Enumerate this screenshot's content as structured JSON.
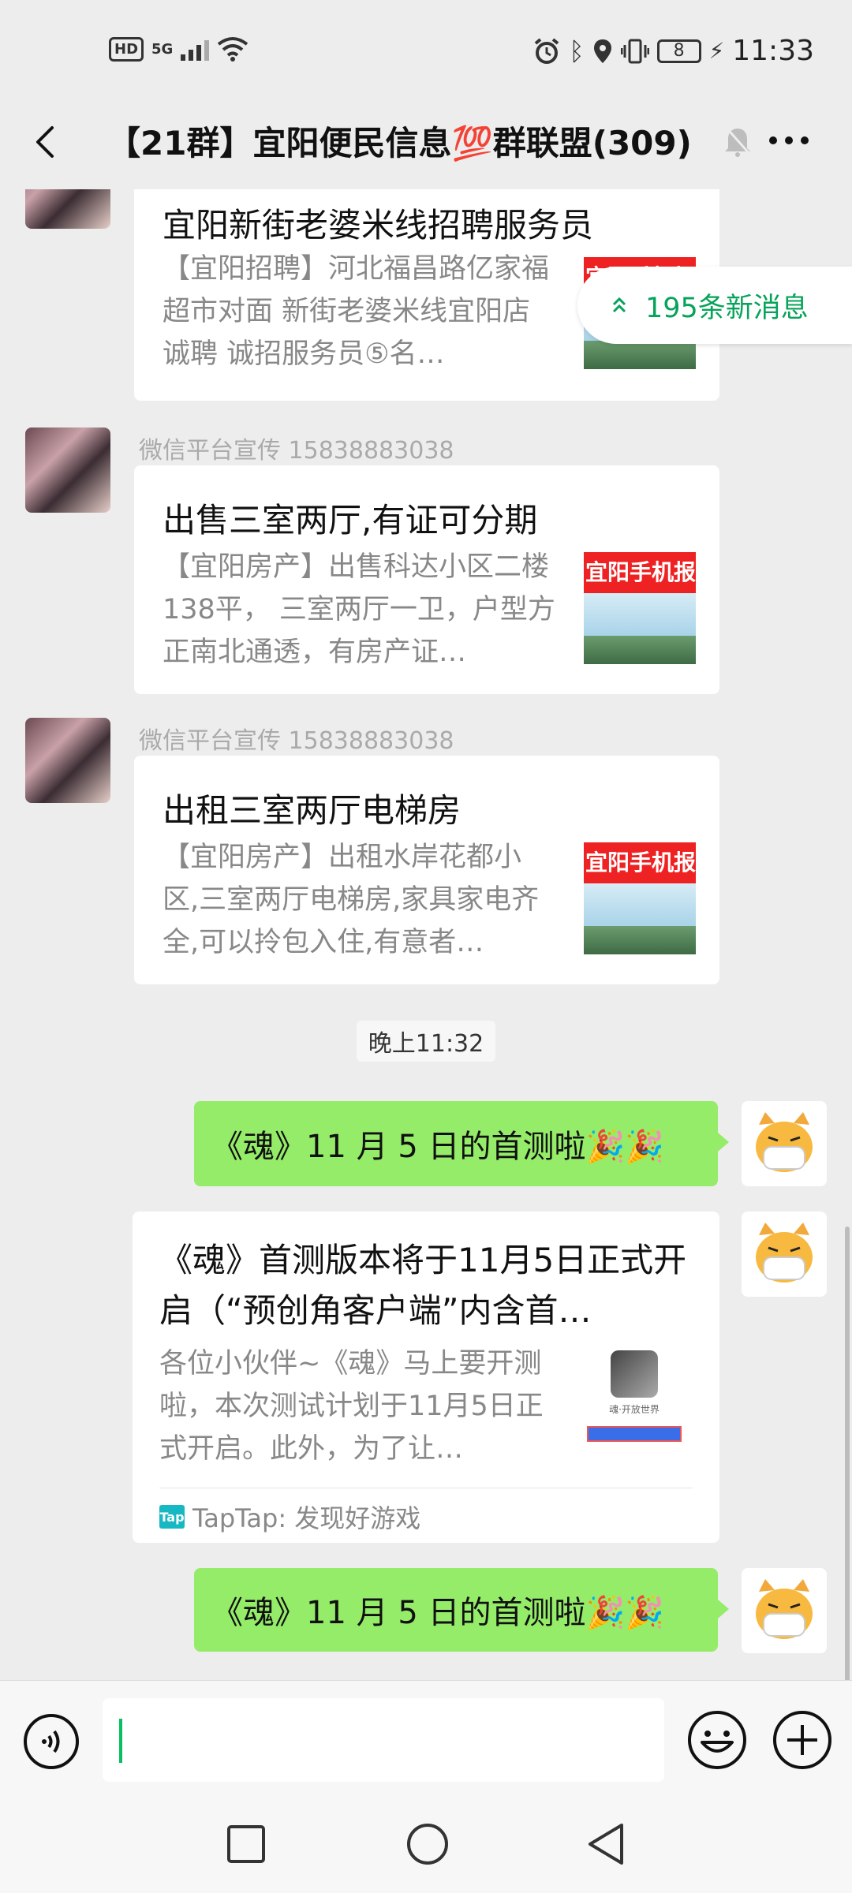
{
  "status_bar": {
    "hd": "HD",
    "network": "5G",
    "battery": "8",
    "time": "11:33"
  },
  "header": {
    "title": "【21群】宜阳便民信息💯群联盟(309)"
  },
  "new_messages": {
    "label": "195条新消息"
  },
  "messages": [
    {
      "sender": "",
      "title": "宜阳新街老婆米线招聘服务员",
      "desc": "【宜阳招聘】河北福昌路亿家福超市对面 新街老婆米线宜阳店诚聘 诚招服务员⑤名…",
      "thumb_text": "宜阳手机报"
    },
    {
      "sender": "微信平台宣传  15838883038",
      "title": "出售三室两厅,有证可分期",
      "desc": "【宜阳房产】出售科达小区二楼138平， 三室两厅一卫，户型方正南北通透，有房产证…",
      "thumb_text": "宜阳手机报"
    },
    {
      "sender": "微信平台宣传  15838883038",
      "title": "出租三室两厅电梯房",
      "desc": "【宜阳房产】出租水岸花都小区,三室两厅电梯房,家具家电齐全,可以拎包入住,有意者…",
      "thumb_text": "宜阳手机报"
    }
  ],
  "timestamp": "晚上11:32",
  "outgoing_1": "《魂》11 月 5 日的首测啦🎉🎉",
  "link_card": {
    "title": "《魂》首测版本将于11月5日正式开启（“预创角客户端”内含首…",
    "desc": "各位小伙伴~《魂》马上要开测啦，本次测试计划于11月5日正式开启。此外，为了让…",
    "source": "TapTap: 发现好游戏",
    "tap_logo": "Tap",
    "thumb_caption": "魂·开放世界"
  },
  "outgoing_2": "《魂》11 月 5 日的首测啦🎉🎉",
  "input": {
    "value": "",
    "placeholder": ""
  },
  "colors": {
    "bubble_green": "#95ec69",
    "accent_green": "#07c160",
    "background": "#ededed"
  }
}
